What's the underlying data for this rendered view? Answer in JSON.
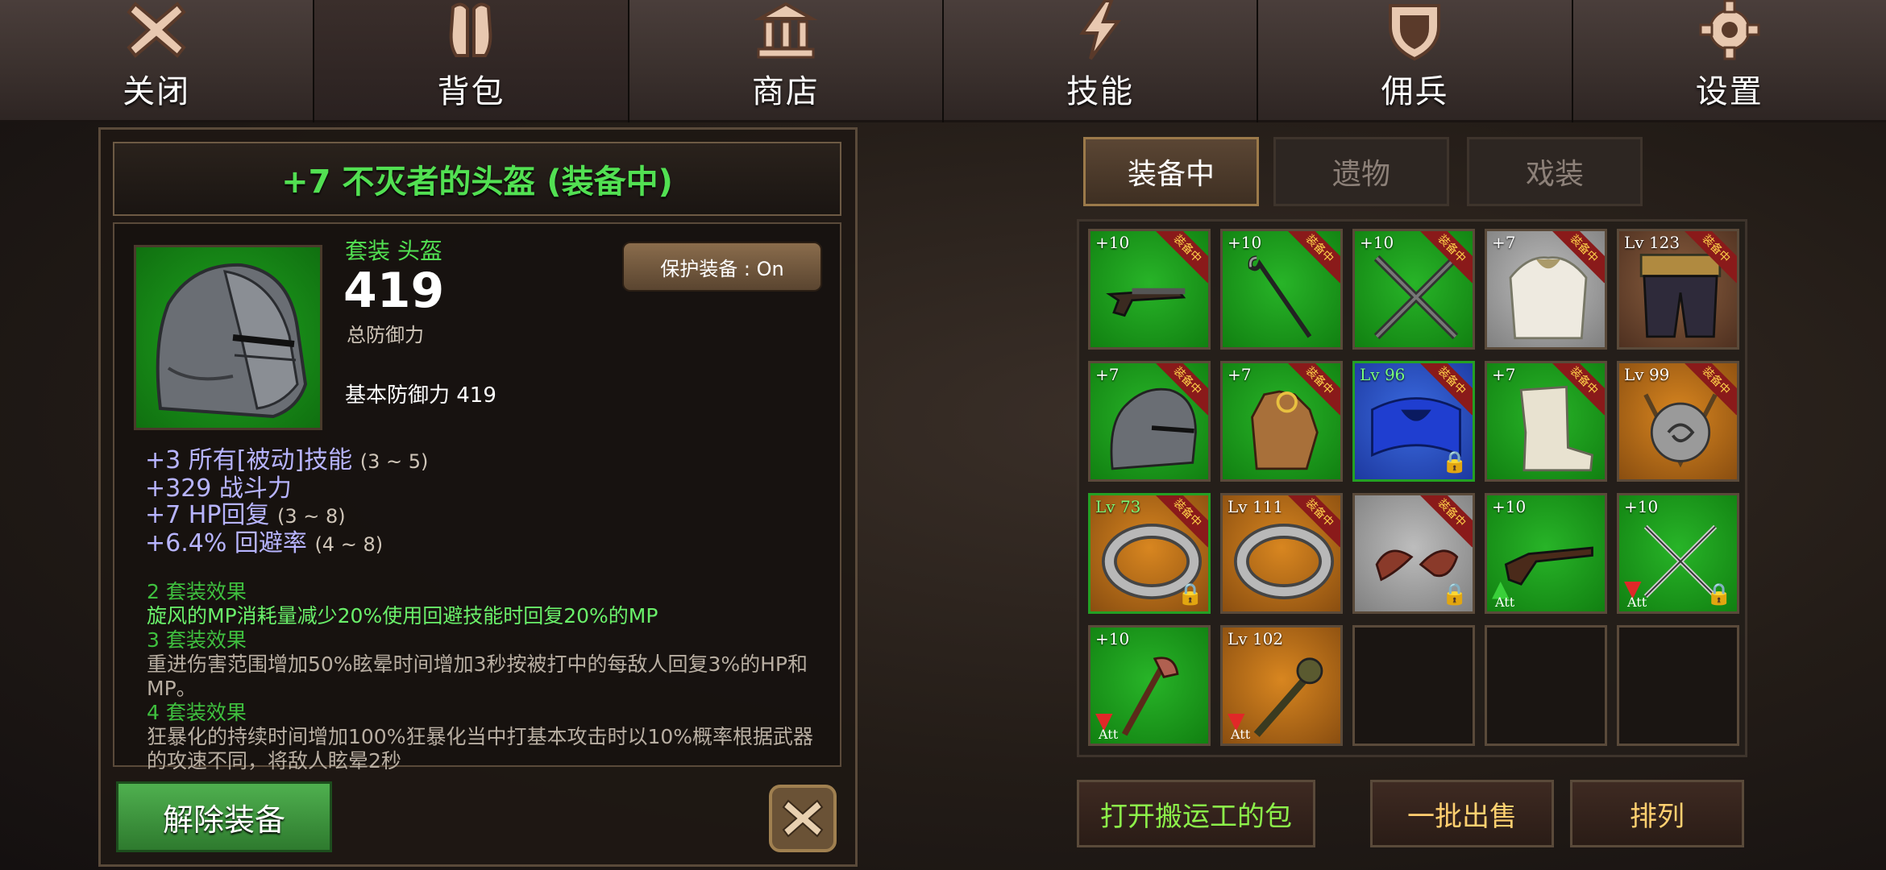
{
  "nav": {
    "items": [
      {
        "label": "关闭",
        "icon": "close-x-icon"
      },
      {
        "label": "背包",
        "icon": "backpack-icon",
        "active": true
      },
      {
        "label": "商店",
        "icon": "shop-building-icon"
      },
      {
        "label": "技能",
        "icon": "lightning-icon"
      },
      {
        "label": "佣兵",
        "icon": "shield-icon"
      },
      {
        "label": "设置",
        "icon": "gear-icon"
      }
    ]
  },
  "detail": {
    "title": "+7 不灭者的头盔 (装备中)",
    "set_type": "套装 头盔",
    "total_defense": "419",
    "total_defense_label": "总防御力",
    "base_defense": "基本防御力 419",
    "protect_button": "保护装备 : On",
    "stats": [
      {
        "text": "+3 所有[被动]技能",
        "range": "(3 ~ 5)"
      },
      {
        "text": "+329 战斗力",
        "range": ""
      },
      {
        "text": "+7 HP回复",
        "range": "(3 ~ 8)"
      },
      {
        "text": "+6.4% 回避率",
        "range": "(4 ~ 8)"
      }
    ],
    "set_effects": {
      "s2_title": "2 套装效果",
      "s2_text": "旋风的MP消耗量减少20%使用回避技能时回复20%的MP",
      "s3_title": "3 套装效果",
      "s3_text": "重进伤害范围增加50%眩晕时间增加3秒按被打中的每敌人回复3%的HP和MP。",
      "s4_title": "4 套装效果",
      "s4_text": "狂暴化的持续时间增加100%狂暴化当中打基本攻击时以10%概率根据武器的攻速不同，将敌人眩晕2秒"
    },
    "unequip_button": "解除装备"
  },
  "tabs": [
    "装备中",
    "遗物",
    "戏装"
  ],
  "equipped_tag": "装备中",
  "att_label": "Att",
  "slots": [
    {
      "lvl": "+10",
      "bg": "green",
      "equipped": true,
      "icon": "pistol-icon"
    },
    {
      "lvl": "+10",
      "bg": "green",
      "equipped": true,
      "icon": "staff-icon"
    },
    {
      "lvl": "+10",
      "bg": "green",
      "equipped": true,
      "icon": "crossed-swords-icon"
    },
    {
      "lvl": "+7",
      "bg": "white",
      "equipped": true,
      "icon": "white-armor-icon"
    },
    {
      "lvl": "Lv 123",
      "bg": "brown",
      "equipped": true,
      "icon": "dark-pants-icon"
    },
    {
      "lvl": "+7",
      "bg": "green",
      "equipped": true,
      "icon": "knight-helmet-icon"
    },
    {
      "lvl": "+7",
      "bg": "green",
      "equipped": true,
      "icon": "leather-glove-icon"
    },
    {
      "lvl": "Lv 96",
      "bg": "blue",
      "equipped": true,
      "locked": true,
      "icon": "blue-belt-icon",
      "lvlgreen": true,
      "gborder": true
    },
    {
      "lvl": "+7",
      "bg": "green",
      "equipped": true,
      "icon": "white-boots-icon"
    },
    {
      "lvl": "Lv 99",
      "bg": "orange",
      "equipped": true,
      "icon": "amulet-icon"
    },
    {
      "lvl": "Lv 73",
      "bg": "orange",
      "equipped": true,
      "locked": true,
      "icon": "silver-ring-icon",
      "lvlgreen": true,
      "gborder": true
    },
    {
      "lvl": "Lv 111",
      "bg": "orange",
      "equipped": true,
      "icon": "silver-ring-icon"
    },
    {
      "lvl": "",
      "bg": "white",
      "equipped": true,
      "locked": true,
      "icon": "bat-wings-icon"
    },
    {
      "lvl": "+10",
      "bg": "green",
      "arrow": "up",
      "att": true,
      "icon": "shotgun-icon"
    },
    {
      "lvl": "+10",
      "bg": "green",
      "arrow": "down",
      "att": true,
      "locked": true,
      "icon": "crossed-daggers-icon"
    },
    {
      "lvl": "+10",
      "bg": "green",
      "arrow": "down",
      "att": true,
      "icon": "axe-staff-icon"
    },
    {
      "lvl": "Lv 102",
      "bg": "orange",
      "arrow": "down",
      "att": true,
      "icon": "spiked-mace-icon"
    },
    {
      "lvl": "",
      "bg": "empty"
    },
    {
      "lvl": "",
      "bg": "empty"
    },
    {
      "lvl": "",
      "bg": "empty"
    }
  ],
  "bottom_buttons": {
    "porter_bag": "打开搬运工的包",
    "bulk_sell": "一批出售",
    "sort": "排列"
  },
  "colors": {
    "set_green": "#3fc03f",
    "stat_purple": "#b7b4ff",
    "title_green": "#52e052",
    "equipped_red": "#8a1a1a"
  }
}
